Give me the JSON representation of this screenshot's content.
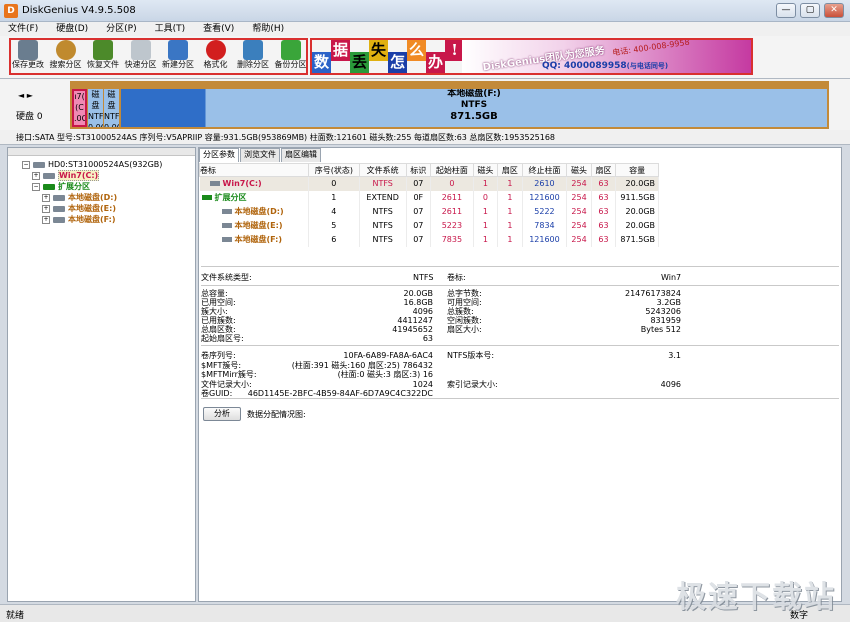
{
  "window": {
    "title": "DiskGenius V4.9.5.508"
  },
  "menu": [
    "文件(F)",
    "硬盘(D)",
    "分区(P)",
    "工具(T)",
    "查看(V)",
    "帮助(H)"
  ],
  "toolbar": [
    {
      "label": "保存更改",
      "icon": "save-icon",
      "color": "#6a7d8f"
    },
    {
      "label": "搜索分区",
      "icon": "search-icon",
      "color": "#c08a2e"
    },
    {
      "label": "恢复文件",
      "icon": "recover-icon",
      "color": "#4c8a2a"
    },
    {
      "label": "快速分区",
      "icon": "quick-partition-icon",
      "color": "#9aa6b2"
    },
    {
      "label": "新建分区",
      "icon": "new-partition-icon",
      "color": "#3a76c4"
    },
    {
      "label": "格式化",
      "icon": "format-icon",
      "color": "#d21f1f"
    },
    {
      "label": "删除分区",
      "icon": "delete-icon",
      "color": "#3b7fbd"
    },
    {
      "label": "备份分区",
      "icon": "backup-icon",
      "color": "#3aa53a"
    }
  ],
  "banner": {
    "chars": [
      "数",
      "据",
      "丢",
      "失",
      "怎",
      "么",
      "办",
      "!"
    ],
    "brand": "DiskGenius团队为您服务",
    "phone": "电话: 400-008-9958",
    "qq": "QQ: 4000089958",
    "qq_note": "(与电话同号)"
  },
  "disk_map": {
    "disk_label": "硬盘 0",
    "nav": "◄ ►",
    "partitions": [
      {
        "lines": [
          "ı7(",
          "(C",
          ".0G"
        ],
        "color": "#f08ab4"
      },
      {
        "lines": [
          "磁盘",
          "NTFS",
          "0.0G"
        ],
        "color": "#9ac0e8"
      },
      {
        "lines": [
          "磁盘",
          "NTFS",
          "0.0G"
        ],
        "color": "#9ac0e8"
      },
      {
        "lines": [
          "本地磁盘(F:)",
          "NTFS",
          "871.5GB"
        ],
        "color": "#9ac0e8"
      }
    ]
  },
  "disk_info": "接口:SATA  型号:ST31000524AS  序列号:V5APRIIP  容量:931.5GB(953869MB)  柱面数:121601  磁头数:255  每道扇区数:63  总扇区数:1953525168",
  "tree": {
    "root": "HD0:ST31000524AS(932GB)",
    "items": [
      {
        "label": "Win7(C:)",
        "level": 2,
        "style": "sel"
      },
      {
        "label": "扩展分区",
        "level": 2,
        "style": "ext"
      },
      {
        "label": "本地磁盘(D:)",
        "level": 3,
        "style": "vol"
      },
      {
        "label": "本地磁盘(E:)",
        "level": 3,
        "style": "vol"
      },
      {
        "label": "本地磁盘(F:)",
        "level": 3,
        "style": "vol"
      }
    ]
  },
  "tabs": [
    "分区参数",
    "浏览文件",
    "扇区编辑"
  ],
  "table": {
    "headers": [
      "卷标",
      "序号(状态)",
      "文件系统",
      "标识",
      "起始柱面",
      "磁头",
      "扇区",
      "终止柱面",
      "磁头",
      "扇区",
      "容量"
    ],
    "rows": [
      [
        "Win7(C:)",
        "0",
        "NTFS",
        "07",
        "0",
        "1",
        "1",
        "2610",
        "254",
        "63",
        "20.0GB"
      ],
      [
        "扩展分区",
        "1",
        "EXTEND",
        "0F",
        "2611",
        "0",
        "1",
        "121600",
        "254",
        "63",
        "911.5GB"
      ],
      [
        "本地磁盘(D:)",
        "4",
        "NTFS",
        "07",
        "2611",
        "1",
        "1",
        "5222",
        "254",
        "63",
        "20.0GB"
      ],
      [
        "本地磁盘(E:)",
        "5",
        "NTFS",
        "07",
        "5223",
        "1",
        "1",
        "7834",
        "254",
        "63",
        "20.0GB"
      ],
      [
        "本地磁盘(F:)",
        "6",
        "NTFS",
        "07",
        "7835",
        "1",
        "1",
        "121600",
        "254",
        "63",
        "871.5GB"
      ]
    ]
  },
  "details": {
    "fs_type_label": "文件系统类型:",
    "fs_type": "NTFS",
    "vol_label_label": "卷标:",
    "vol_label": "Win7",
    "left": [
      [
        "总容量:",
        "20.0GB"
      ],
      [
        "已用空间:",
        "16.8GB"
      ],
      [
        "簇大小:",
        "4096"
      ],
      [
        "已用簇数:",
        "4411247"
      ],
      [
        "总扇区数:",
        "41945652"
      ],
      [
        "起始扇区号:",
        "63"
      ]
    ],
    "right": [
      [
        "总字节数:",
        "21476173824"
      ],
      [
        "可用空间:",
        "3.2GB"
      ],
      [
        "总簇数:",
        "5243206"
      ],
      [
        "空闲簇数:",
        "831959"
      ],
      [
        "扇区大小:",
        "512 Bytes"
      ]
    ],
    "left2": [
      [
        "卷序列号:",
        "10FA-6A89-FA8A-6AC4"
      ],
      [
        "$MFT簇号:",
        "786432 (柱面:391 磁头:160 扇区:25)"
      ],
      [
        "$MFTMirr簇号:",
        "16 (柱面:0 磁头:3 扇区:3)"
      ],
      [
        "文件记录大小:",
        "1024"
      ],
      [
        "卷GUID:",
        "46D1145E-2BFC-4B59-84AF-6D7A9C4C322DC"
      ]
    ],
    "right2": [
      [
        "NTFS版本号:",
        "3.1"
      ],
      [
        "",
        ""
      ],
      [
        "",
        ""
      ],
      [
        "索引记录大小:",
        "4096"
      ]
    ],
    "analyze": "分析",
    "alloc_label": "数据分配情况图:"
  },
  "status": {
    "left": "就绪",
    "right": "数字"
  },
  "watermark": "极速下载站"
}
